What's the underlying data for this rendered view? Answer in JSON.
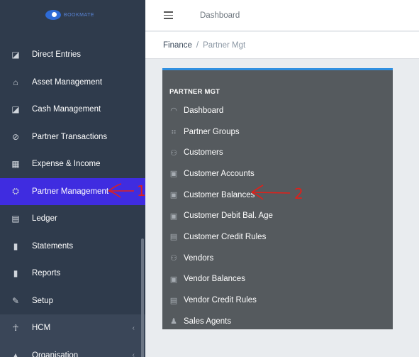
{
  "sidebar": {
    "logo_text": "BOOKMATE",
    "items": [
      {
        "label": "Direct Entries",
        "icon": "direct-entries-icon",
        "glyph": "◪"
      },
      {
        "label": "Asset Management",
        "icon": "asset-icon",
        "glyph": "⌂"
      },
      {
        "label": "Cash Management",
        "icon": "cash-icon",
        "glyph": "◪"
      },
      {
        "label": "Partner Transactions",
        "icon": "partner-transactions-icon",
        "glyph": "⊘"
      },
      {
        "label": "Expense & Income",
        "icon": "calculator-icon",
        "glyph": "▦"
      },
      {
        "label": "Partner Management",
        "icon": "partner-management-icon",
        "glyph": "⛭"
      },
      {
        "label": "Ledger",
        "icon": "ledger-icon",
        "glyph": "▤"
      },
      {
        "label": "Statements",
        "icon": "statements-icon",
        "glyph": "▮"
      },
      {
        "label": "Reports",
        "icon": "reports-icon",
        "glyph": "▮"
      },
      {
        "label": "Setup",
        "icon": "wrench-icon",
        "glyph": "✎"
      },
      {
        "label": "HCM",
        "icon": "person-icon",
        "glyph": "☥"
      },
      {
        "label": "Organisation",
        "icon": "organisation-icon",
        "glyph": "▲"
      }
    ],
    "annotation_1": "1"
  },
  "topbar": {
    "title": "Dashboard"
  },
  "breadcrumb": {
    "parent": "Finance",
    "separator": "/",
    "current": "Partner Mgt"
  },
  "panel": {
    "title": "PARTNER MGT",
    "items": [
      {
        "label": "Dashboard",
        "icon": "dashboard-icon",
        "glyph": "◠"
      },
      {
        "label": "Partner Groups",
        "icon": "group-icon",
        "glyph": "⠶"
      },
      {
        "label": "Customers",
        "icon": "customers-icon",
        "glyph": "⚇"
      },
      {
        "label": "Customer Accounts",
        "icon": "account-icon",
        "glyph": "▣"
      },
      {
        "label": "Customer Balances",
        "icon": "balance-icon",
        "glyph": "▣"
      },
      {
        "label": "Customer Debit Bal. Age",
        "icon": "debit-icon",
        "glyph": "▣"
      },
      {
        "label": "Customer Credit Rules",
        "icon": "rules-icon",
        "glyph": "▤"
      },
      {
        "label": "Vendors",
        "icon": "vendors-icon",
        "glyph": "⚇"
      },
      {
        "label": "Vendor Balances",
        "icon": "vendor-balance-icon",
        "glyph": "▣"
      },
      {
        "label": "Vendor Credit Rules",
        "icon": "vendor-rules-icon",
        "glyph": "▤"
      },
      {
        "label": "Sales Agents",
        "icon": "agent-icon",
        "glyph": "♟"
      }
    ],
    "annotation_2": "2"
  },
  "colors": {
    "active": "#3f2ce0",
    "sidebar": "#2f3b4c",
    "panel": "#555a5e",
    "panel_accent": "#2f8fe0",
    "annotation": "#e0201a"
  }
}
